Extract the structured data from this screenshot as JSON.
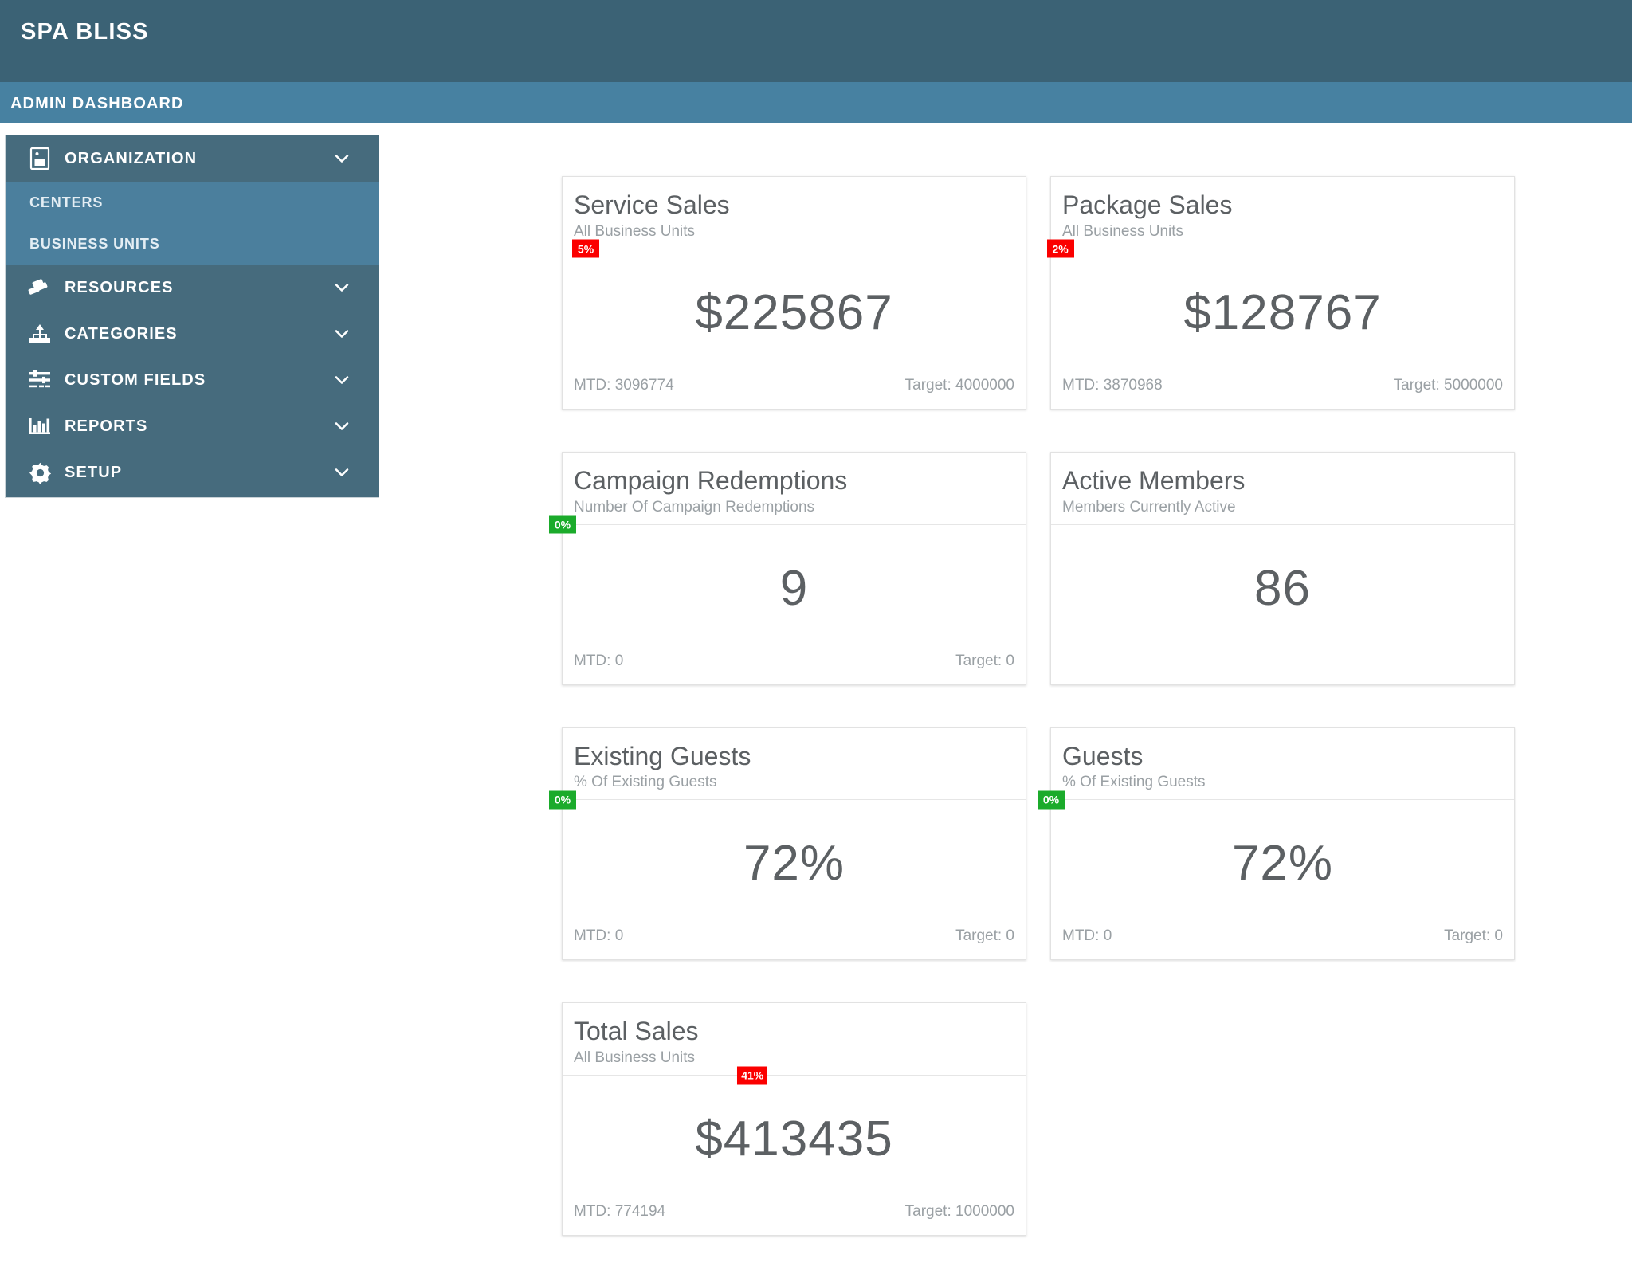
{
  "header": {
    "brand": "SPA BLISS",
    "sub_title": "ADMIN DASHBOARD",
    "brand_bg": "#3b6275",
    "sub_bg": "#4781a1"
  },
  "sidebar": {
    "bg": "#466b7d",
    "submenu_bg": "#4b7f9d",
    "groups": [
      {
        "label": "ORGANIZATION",
        "icon": "organization-icon",
        "chevron": "chevron-down-icon",
        "expanded": true,
        "children": [
          {
            "label": "CENTERS"
          },
          {
            "label": "BUSINESS UNITS"
          }
        ]
      },
      {
        "label": "RESOURCES",
        "icon": "resources-icon",
        "chevron": "chevron-down-icon",
        "expanded": false,
        "children": []
      },
      {
        "label": "CATEGORIES",
        "icon": "categories-icon",
        "chevron": "chevron-down-icon",
        "expanded": false,
        "children": []
      },
      {
        "label": "CUSTOM FIELDS",
        "icon": "custom-fields-icon",
        "chevron": "chevron-down-icon",
        "expanded": false,
        "children": []
      },
      {
        "label": "REPORTS",
        "icon": "reports-icon",
        "chevron": "chevron-down-icon",
        "expanded": false,
        "children": []
      },
      {
        "label": "SETUP",
        "icon": "gear-icon",
        "chevron": "chevron-down-icon",
        "expanded": false,
        "children": []
      }
    ]
  },
  "kpi_cards": [
    {
      "title": "Service Sales",
      "subtitle": "All Business Units",
      "badge": {
        "text": "5%",
        "percent": 5,
        "color": "#fb0000"
      },
      "value": "$225867",
      "mtd": "MTD: 3096774",
      "target": "Target: 4000000"
    },
    {
      "title": "Package Sales",
      "subtitle": "All Business Units",
      "badge": {
        "text": "2%",
        "percent": 2,
        "color": "#fb0000"
      },
      "value": "$128767",
      "mtd": "MTD: 3870968",
      "target": "Target: 5000000"
    },
    {
      "title": "Campaign Redemptions",
      "subtitle": "Number Of Campaign Redemptions",
      "badge": {
        "text": "0%",
        "percent": 0,
        "color": "#1bab2b"
      },
      "value": "9",
      "mtd": "MTD: 0",
      "target": "Target: 0"
    },
    {
      "title": "Active Members",
      "subtitle": "Members Currently Active",
      "badge": null,
      "value": "86",
      "mtd": "",
      "target": ""
    },
    {
      "title": "Existing Guests",
      "subtitle": "% Of Existing Guests",
      "badge": {
        "text": "0%",
        "percent": 0,
        "color": "#1bab2b"
      },
      "value": "72%",
      "mtd": "MTD: 0",
      "target": "Target: 0"
    },
    {
      "title": "Guests",
      "subtitle": "% Of Existing Guests",
      "badge": {
        "text": "0%",
        "percent": 0,
        "color": "#1bab2b"
      },
      "value": "72%",
      "mtd": "MTD: 0",
      "target": "Target: 0"
    },
    {
      "title": "Total Sales",
      "subtitle": "All Business Units",
      "badge": {
        "text": "41%",
        "percent": 41,
        "color": "#fb0000"
      },
      "value": "$413435",
      "mtd": "MTD: 774194",
      "target": "Target: 1000000"
    }
  ]
}
